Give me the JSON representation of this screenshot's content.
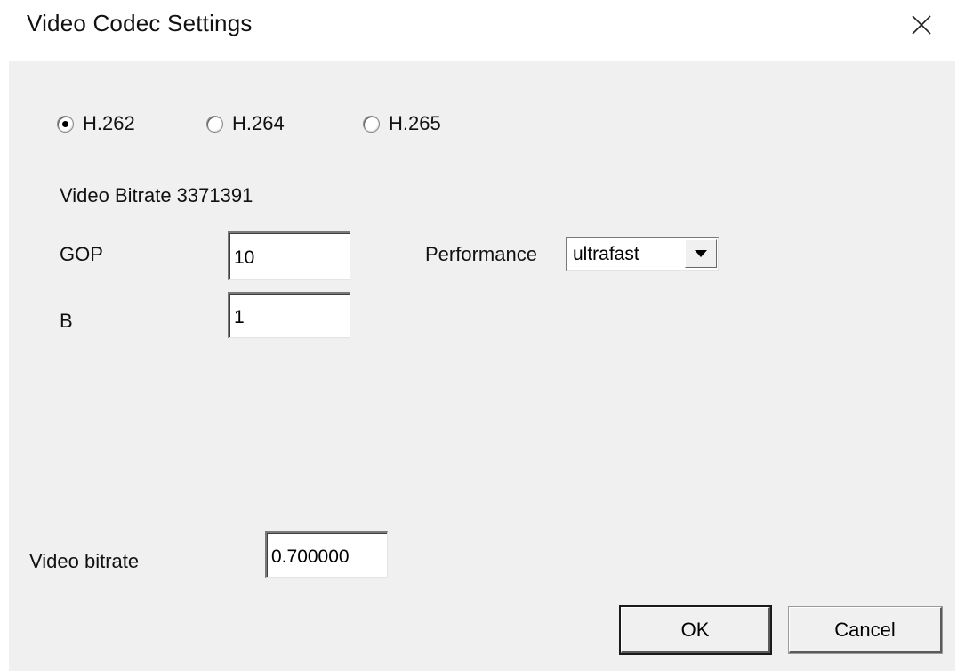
{
  "window": {
    "title": "Video Codec Settings"
  },
  "codec": {
    "options": [
      {
        "label": "H.262",
        "checked": true
      },
      {
        "label": "H.264",
        "checked": false
      },
      {
        "label": "H.265",
        "checked": false
      }
    ]
  },
  "info": {
    "bitrate_text": "Video Bitrate 3371391"
  },
  "fields": {
    "gop_label": "GOP",
    "gop_value": "10",
    "b_label": "B",
    "b_value": "1",
    "performance_label": "Performance",
    "performance_value": "ultrafast",
    "video_bitrate_label": "Video bitrate",
    "video_bitrate_value": "0.700000"
  },
  "buttons": {
    "ok_label": "OK",
    "cancel_label": "Cancel"
  },
  "icons": {
    "close": "close-icon",
    "dropdown": "chevron-down-icon"
  },
  "colors": {
    "client_background": "#f0f0f0",
    "title_background": "#ffffff"
  }
}
